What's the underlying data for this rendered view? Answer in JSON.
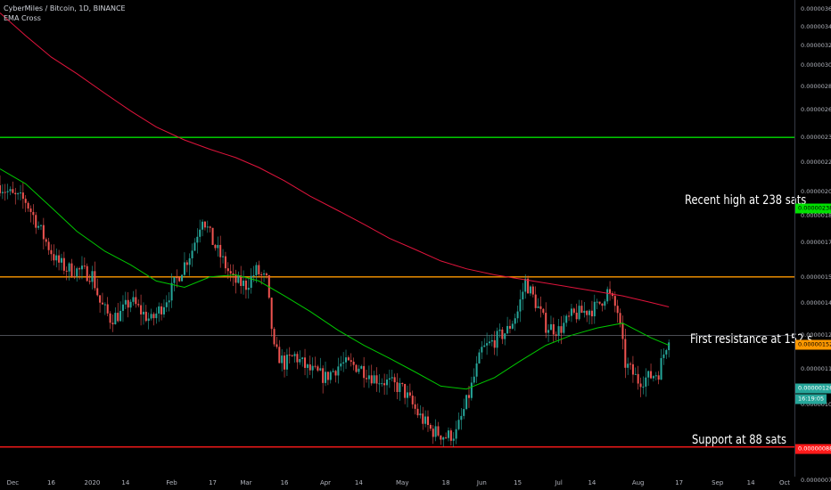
{
  "header": {
    "title": "CyberMiles / Bitcoin, 1D, BINANCE",
    "indicator": "EMA Cross"
  },
  "annotations": {
    "recent_high": "Recent high at 238 sats",
    "first_resistance": "First resistance at 152 s",
    "support": "Support at 88 sats"
  },
  "badges": {
    "recent_high": "0.00000238",
    "first_resistance": "0.00000152",
    "last_price": "0.00000126",
    "countdown": "16:19:05",
    "support": "0.00000088"
  },
  "colors": {
    "background": "#000000",
    "candle_up": "#26a69a",
    "candle_down": "#ef5350",
    "ema_fast": "#00c800",
    "ema_slow": "#e0143c",
    "recent_high_line": "#00e000",
    "resistance_line": "#ff9800",
    "support_line": "#ff1a1a",
    "last_price_line": "#787b86"
  },
  "chart_data": {
    "type": "candlestick",
    "y_scale": "log",
    "ylim": [
      8e-07,
      3.7e-06
    ],
    "xlim": [
      "2019-11-26",
      "2020-10-01"
    ],
    "y_ticks": [
      "0.00000360",
      "0.00000340",
      "0.00000320",
      "0.00000300",
      "0.00000280",
      "0.00000260",
      "0.00000238",
      "0.00000220",
      "0.00000200",
      "0.00000185",
      "0.00000170",
      "0.00000152",
      "0.00000140",
      "0.00000126",
      "0.00000113",
      "0.00000101",
      "0.00000088",
      "0.00000079"
    ],
    "x_ticks": [
      "Dec",
      "16",
      "2020",
      "14",
      "Feb",
      "17",
      "Mar",
      "16",
      "Apr",
      "14",
      "May",
      "18",
      "Jun",
      "15",
      "Jul",
      "14",
      "Aug",
      "17",
      "Sep",
      "14",
      "Oct"
    ],
    "x_tick_dates": [
      "2019-12-01",
      "2019-12-16",
      "2020-01-01",
      "2020-01-14",
      "2020-02-01",
      "2020-02-17",
      "2020-03-01",
      "2020-03-16",
      "2020-04-01",
      "2020-04-14",
      "2020-05-01",
      "2020-05-18",
      "2020-06-01",
      "2020-06-15",
      "2020-07-01",
      "2020-07-14",
      "2020-08-01",
      "2020-08-17",
      "2020-09-01",
      "2020-09-14",
      "2020-10-01"
    ],
    "horizontal_levels": [
      {
        "label": "Recent high at 238 sats",
        "value": 2.38e-06
      },
      {
        "label": "First resistance at 152 s",
        "value": 1.52e-06
      },
      {
        "label": "Support at 88 sats",
        "value": 8.8e-07
      },
      {
        "label": "0.00000126",
        "value": 1.26e-06
      }
    ],
    "close_path": [
      [
        "2019-11-26",
        2.04
      ],
      [
        "2019-12-01",
        1.97
      ],
      [
        "2019-12-06",
        1.94
      ],
      [
        "2019-12-10",
        1.82
      ],
      [
        "2019-12-14",
        1.7
      ],
      [
        "2019-12-18",
        1.6
      ],
      [
        "2019-12-22",
        1.56
      ],
      [
        "2019-12-27",
        1.55
      ],
      [
        "2020-01-01",
        1.53
      ],
      [
        "2020-01-04",
        1.4
      ],
      [
        "2020-01-08",
        1.33
      ],
      [
        "2020-01-12",
        1.35
      ],
      [
        "2020-01-16",
        1.41
      ],
      [
        "2020-01-20",
        1.36
      ],
      [
        "2020-01-24",
        1.32
      ],
      [
        "2020-01-28",
        1.38
      ],
      [
        "2020-02-01",
        1.46
      ],
      [
        "2020-02-05",
        1.56
      ],
      [
        "2020-02-09",
        1.66
      ],
      [
        "2020-02-13",
        1.85
      ],
      [
        "2020-02-17",
        1.7
      ],
      [
        "2020-02-21",
        1.6
      ],
      [
        "2020-02-25",
        1.5
      ],
      [
        "2020-03-01",
        1.48
      ],
      [
        "2020-03-05",
        1.55
      ],
      [
        "2020-03-09",
        1.5
      ],
      [
        "2020-03-12",
        1.2
      ],
      [
        "2020-03-16",
        1.15
      ],
      [
        "2020-03-20",
        1.18
      ],
      [
        "2020-03-25",
        1.13
      ],
      [
        "2020-04-01",
        1.1
      ],
      [
        "2020-04-07",
        1.15
      ],
      [
        "2020-04-14",
        1.14
      ],
      [
        "2020-04-20",
        1.1
      ],
      [
        "2020-04-26",
        1.08
      ],
      [
        "2020-05-01",
        1.06
      ],
      [
        "2020-05-07",
        0.98
      ],
      [
        "2020-05-12",
        0.93
      ],
      [
        "2020-05-18",
        0.91
      ],
      [
        "2020-05-22",
        0.92
      ],
      [
        "2020-05-27",
        1.04
      ],
      [
        "2020-06-01",
        1.2
      ],
      [
        "2020-06-06",
        1.24
      ],
      [
        "2020-06-11",
        1.28
      ],
      [
        "2020-06-15",
        1.36
      ],
      [
        "2020-06-18",
        1.5
      ],
      [
        "2020-06-22",
        1.4
      ],
      [
        "2020-06-26",
        1.3
      ],
      [
        "2020-07-01",
        1.28
      ],
      [
        "2020-07-06",
        1.34
      ],
      [
        "2020-07-11",
        1.36
      ],
      [
        "2020-07-16",
        1.38
      ],
      [
        "2020-07-20",
        1.45
      ],
      [
        "2020-07-24",
        1.36
      ],
      [
        "2020-07-27",
        1.15
      ],
      [
        "2020-08-01",
        1.09
      ],
      [
        "2020-08-05",
        1.1
      ],
      [
        "2020-08-09",
        1.12
      ],
      [
        "2020-08-13",
        1.26
      ]
    ],
    "series": [
      {
        "key": "ema_fast",
        "points": [
          [
            "2019-11-26",
            2.15
          ],
          [
            "2019-12-06",
            2.05
          ],
          [
            "2019-12-16",
            1.9
          ],
          [
            "2019-12-26",
            1.76
          ],
          [
            "2020-01-06",
            1.65
          ],
          [
            "2020-01-16",
            1.58
          ],
          [
            "2020-01-26",
            1.5
          ],
          [
            "2020-02-06",
            1.47
          ],
          [
            "2020-02-16",
            1.52
          ],
          [
            "2020-02-26",
            1.53
          ],
          [
            "2020-03-06",
            1.5
          ],
          [
            "2020-03-16",
            1.43
          ],
          [
            "2020-03-26",
            1.36
          ],
          [
            "2020-04-06",
            1.28
          ],
          [
            "2020-04-16",
            1.22
          ],
          [
            "2020-04-26",
            1.17
          ],
          [
            "2020-05-06",
            1.12
          ],
          [
            "2020-05-16",
            1.07
          ],
          [
            "2020-05-26",
            1.06
          ],
          [
            "2020-06-06",
            1.1
          ],
          [
            "2020-06-16",
            1.16
          ],
          [
            "2020-06-26",
            1.22
          ],
          [
            "2020-07-06",
            1.26
          ],
          [
            "2020-07-16",
            1.29
          ],
          [
            "2020-07-26",
            1.31
          ],
          [
            "2020-08-06",
            1.25
          ],
          [
            "2020-08-13",
            1.22
          ]
        ]
      },
      {
        "key": "ema_slow",
        "points": [
          [
            "2019-11-26",
            3.55
          ],
          [
            "2019-12-06",
            3.3
          ],
          [
            "2019-12-16",
            3.08
          ],
          [
            "2019-12-26",
            2.92
          ],
          [
            "2020-01-06",
            2.74
          ],
          [
            "2020-01-16",
            2.59
          ],
          [
            "2020-01-26",
            2.46
          ],
          [
            "2020-02-06",
            2.36
          ],
          [
            "2020-02-16",
            2.29
          ],
          [
            "2020-02-26",
            2.23
          ],
          [
            "2020-03-06",
            2.16
          ],
          [
            "2020-03-16",
            2.07
          ],
          [
            "2020-03-26",
            1.97
          ],
          [
            "2020-04-06",
            1.88
          ],
          [
            "2020-04-16",
            1.8
          ],
          [
            "2020-04-26",
            1.72
          ],
          [
            "2020-05-06",
            1.66
          ],
          [
            "2020-05-16",
            1.6
          ],
          [
            "2020-05-26",
            1.56
          ],
          [
            "2020-06-06",
            1.53
          ],
          [
            "2020-06-16",
            1.51
          ],
          [
            "2020-06-26",
            1.49
          ],
          [
            "2020-07-06",
            1.47
          ],
          [
            "2020-07-16",
            1.45
          ],
          [
            "2020-07-26",
            1.43
          ],
          [
            "2020-08-06",
            1.4
          ],
          [
            "2020-08-13",
            1.38
          ]
        ]
      }
    ]
  }
}
